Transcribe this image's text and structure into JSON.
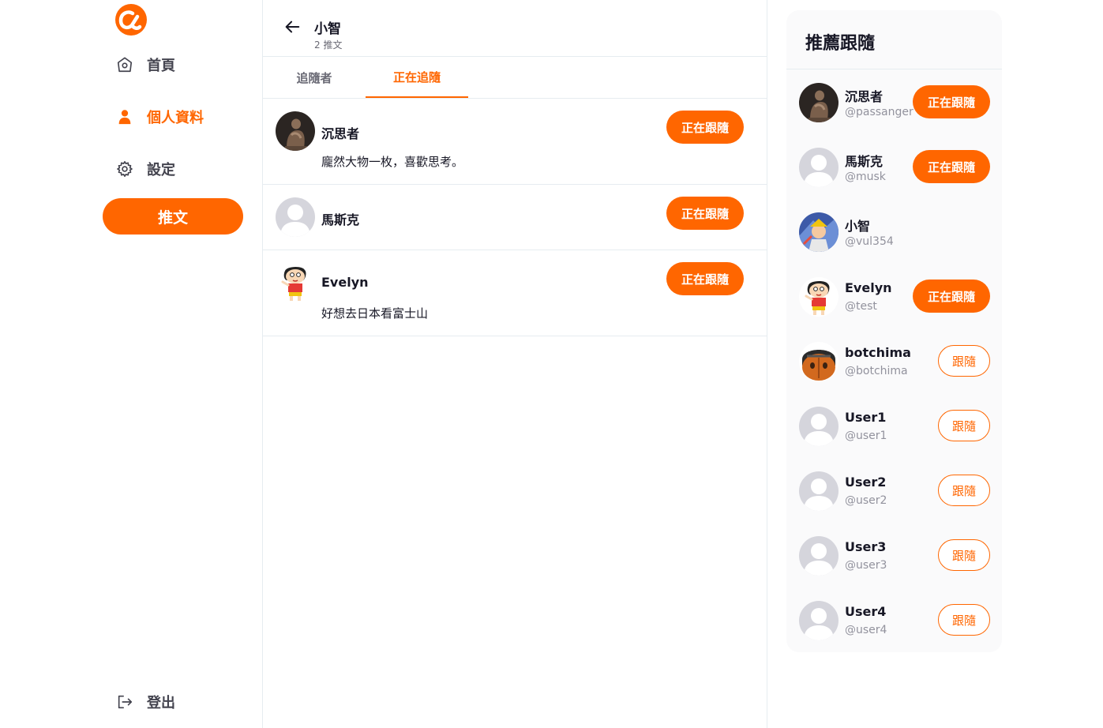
{
  "brand": {
    "accent": "#ff6600",
    "logo_icon": "alpha-logo-icon"
  },
  "sidebar": {
    "items": [
      {
        "label": "首頁",
        "icon": "home-icon"
      },
      {
        "label": "個人資料",
        "icon": "user-icon",
        "active": true
      },
      {
        "label": "設定",
        "icon": "gear-icon"
      }
    ],
    "tweet_button": "推文",
    "logout": {
      "label": "登出",
      "icon": "logout-icon"
    }
  },
  "header": {
    "title": "小智",
    "subtitle": "2 推文",
    "back_icon": "arrow-left-icon"
  },
  "tabs": [
    {
      "label": "追隨者",
      "active": false
    },
    {
      "label": "正在追隨",
      "active": true
    }
  ],
  "following": [
    {
      "name": "沉思者",
      "bio": "龐然大物一枚，喜歡思考。",
      "button": "正在跟隨",
      "avatar": "thinker-avatar"
    },
    {
      "name": "馬斯克",
      "bio": "",
      "button": "正在跟隨",
      "avatar": "default-avatar"
    },
    {
      "name": "Evelyn",
      "bio": "好想去日本看富士山",
      "button": "正在跟隨",
      "avatar": "cartoon-boy-avatar"
    }
  ],
  "recommend": {
    "title": "推薦跟隨",
    "users": [
      {
        "name": "沉思者",
        "handle": "@passanger",
        "button": "正在跟隨",
        "following": true,
        "avatar": "thinker-avatar"
      },
      {
        "name": "馬斯克",
        "handle": "@musk",
        "button": "正在跟隨",
        "following": true,
        "avatar": "default-avatar"
      },
      {
        "name": "小智",
        "handle": "@vul354",
        "button": "",
        "following": null,
        "avatar": "anime-avatar"
      },
      {
        "name": "Evelyn",
        "handle": "@test",
        "button": "正在跟隨",
        "following": true,
        "avatar": "cartoon-boy-avatar"
      },
      {
        "name": "botchima",
        "handle": "@botchima",
        "button": "跟隨",
        "following": false,
        "avatar": "bear-avatar"
      },
      {
        "name": "User1",
        "handle": "@user1",
        "button": "跟隨",
        "following": false,
        "avatar": "default-avatar"
      },
      {
        "name": "User2",
        "handle": "@user2",
        "button": "跟隨",
        "following": false,
        "avatar": "default-avatar"
      },
      {
        "name": "User3",
        "handle": "@user3",
        "button": "跟隨",
        "following": false,
        "avatar": "default-avatar"
      },
      {
        "name": "User4",
        "handle": "@user4",
        "button": "跟隨",
        "following": false,
        "avatar": "default-avatar"
      }
    ]
  }
}
